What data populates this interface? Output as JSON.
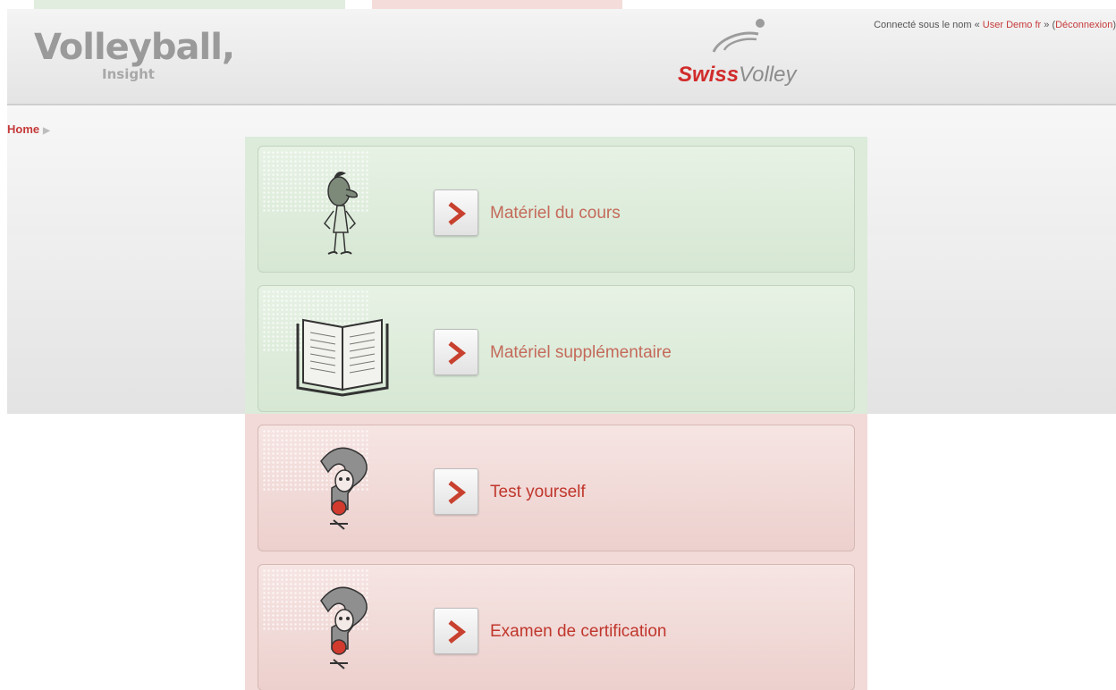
{
  "header": {
    "brand_title": "Volleyball,",
    "brand_subtitle": "Insight",
    "logo_text_a": "Swiss",
    "logo_text_b": "Volley",
    "login_prefix": "Connecté sous le nom «",
    "login_user": "User Demo fr",
    "login_middle": "» (",
    "logout": "Déconnexion",
    "login_suffix": ")"
  },
  "breadcrumb": {
    "home": "Home",
    "arrow_icon": "triangle-right-icon"
  },
  "cards": [
    {
      "label": "Matériel du cours",
      "theme": "green",
      "icon": "character-standing-icon"
    },
    {
      "label": "Matériel supplémentaire",
      "theme": "green",
      "icon": "open-book-icon"
    },
    {
      "label": "Test yourself",
      "theme": "red",
      "icon": "question-mark-character-icon"
    },
    {
      "label": "Examen de certification",
      "theme": "red",
      "icon": "question-mark-character-icon"
    }
  ],
  "colors": {
    "accent_red": "#c63a3a",
    "green_panel": "#dcebda",
    "red_panel": "#f2dad8"
  }
}
